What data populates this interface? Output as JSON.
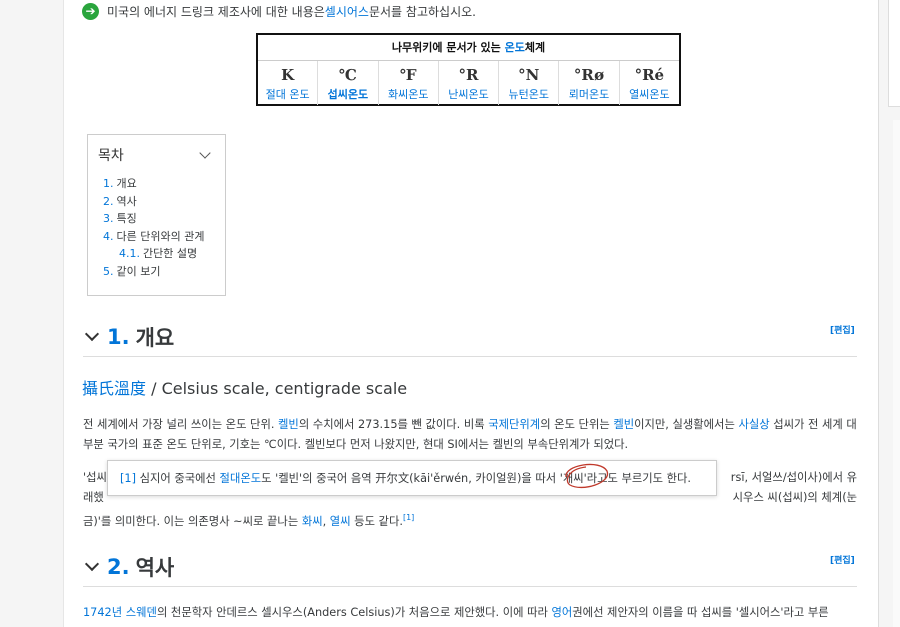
{
  "notice": {
    "pre": "미국의 에너지 드링크 제조사에 대한 내용은 ",
    "link": "셀시어스",
    "post": " 문서를 참고하십시오."
  },
  "navbox": {
    "title_pre": "나무위키에 문서가 있는 ",
    "title_link": "온도",
    "title_post": "체계",
    "units": [
      {
        "symbol": "K",
        "name": "절대 온도",
        "bold": false
      },
      {
        "symbol": "℃",
        "name": "섭씨온도",
        "bold": true
      },
      {
        "symbol": "℉",
        "name": "화씨온도",
        "bold": false
      },
      {
        "symbol": "°R",
        "name": "난씨온도",
        "bold": false
      },
      {
        "symbol": "°N",
        "name": "뉴턴온도",
        "bold": false
      },
      {
        "symbol": "°Rø",
        "name": "뢰머온도",
        "bold": false
      },
      {
        "symbol": "°Ré",
        "name": "열씨온도",
        "bold": false
      }
    ]
  },
  "toc": {
    "title": "목차",
    "items": [
      {
        "num": "1.",
        "label": "개요",
        "sub": false
      },
      {
        "num": "2.",
        "label": "역사",
        "sub": false
      },
      {
        "num": "3.",
        "label": "특징",
        "sub": false
      },
      {
        "num": "4.",
        "label": "다른 단위와의 관계",
        "sub": false
      },
      {
        "num": "4.1.",
        "label": "간단한 설명",
        "sub": true
      },
      {
        "num": "5.",
        "label": "같이 보기",
        "sub": false
      }
    ]
  },
  "sections": {
    "s1": {
      "num": "1.",
      "title": "개요",
      "edit": "[편집]"
    },
    "s2": {
      "num": "2.",
      "title": "역사",
      "edit": "[편집]"
    }
  },
  "alt": {
    "hanja": "攝氏溫度",
    "rest": " / Celsius scale, centigrade scale"
  },
  "para1": {
    "t1": "전 세계에서 가장 널리 쓰이는 온도 단위. ",
    "l1": "켈빈",
    "t2": "의 수치에서 273.15를 뺀 값이다. 비록 ",
    "l2": "국제단위계",
    "t3": "의 온도 단위는 ",
    "l3": "켈빈",
    "t4": "이지만, 실생활에서는 ",
    "l4": "사실상",
    "t5": " 섭씨가 전 세계 대부분 국가의 표준 온도 단위로, 기호는 ℃이다. 켈빈보다 먼저 나왔지만, 현대 SI에서는 켈빈의 부속단위계가 되었다."
  },
  "para2": {
    "line1_start": "'섭씨",
    "line1_end": "rsī, 서얼쓰/섭이사)에서 유",
    "line2_start": "래했",
    "line2_end": "시우스 씨(섭씨)의 체계(눈",
    "line3_a": "금)'를 의미한다. 이는 의존명사 ~씨로 끝나는 ",
    "l_hwa": "화씨",
    "comma": ", ",
    "l_yeol": "열씨",
    "line3_b": " 등도 같다.",
    "ref": "[1]"
  },
  "popup": {
    "ref": "[1]",
    "t1": " 심지어 중국에선 ",
    "link": "절대온도",
    "t2": "도 '켈빈'의 중국어 음역 开尔文(kāi'ěrwén, 카이얼원)을 따서 '개씨'라고도 부르기도 한다."
  },
  "para3": {
    "year": "1742년",
    "country": "스웨덴",
    "t1": "의 천문학자 안데르스 셀시우스(Anders Celsius)가 처음으로 제안했다. 이에 따라 ",
    "l_en": "영어",
    "t2": "권에선 제안자의 이름을 따 섭씨를 '셀시어스'라고 부른"
  }
}
